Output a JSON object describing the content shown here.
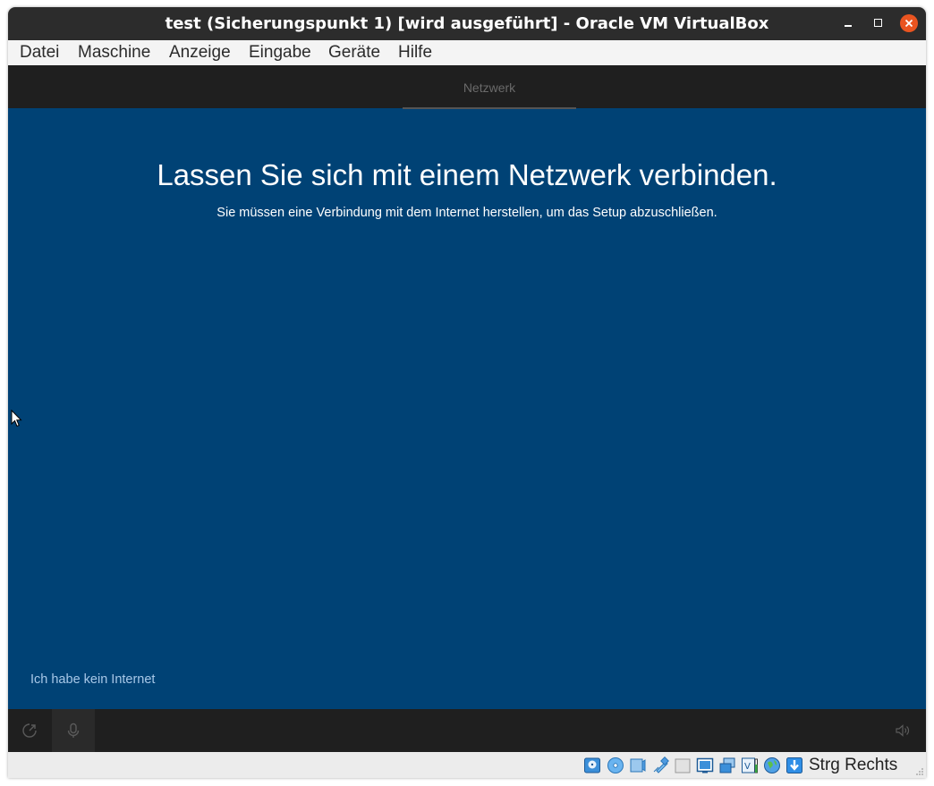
{
  "window": {
    "title": "test (Sicherungspunkt 1) [wird ausgeführt] - Oracle VM VirtualBox",
    "controls": [
      "minimize-icon",
      "maximize-icon",
      "close-icon"
    ]
  },
  "menubar": {
    "items": [
      {
        "label": "Datei"
      },
      {
        "label": "Maschine"
      },
      {
        "label": "Anzeige"
      },
      {
        "label": "Eingabe"
      },
      {
        "label": "Geräte"
      },
      {
        "label": "Hilfe"
      }
    ]
  },
  "guest": {
    "tab_label": "Netzwerk",
    "heading": "Lassen Sie sich mit einem Netzwerk verbinden.",
    "subheading": "Sie müssen eine Verbindung mit dem Internet herstellen, um das Setup abzuschließen.",
    "no_internet_link": "Ich habe kein Internet",
    "footer_icons": [
      "ease-of-access-icon",
      "microphone-icon",
      "volume-icon"
    ]
  },
  "statusbar": {
    "icons": [
      "hard-disk-icon",
      "optical-drive-icon",
      "audio-icon",
      "network-icon",
      "usb-icon",
      "shared-folders-icon",
      "display-icon",
      "video-capture-icon",
      "recording-icon",
      "cpu-virtualization-icon",
      "mouse-integration-icon",
      "keyboard-capture-icon"
    ],
    "host_key": "Strg Rechts"
  },
  "colors": {
    "titlebar": "#2c2c2c",
    "close_button": "#e95420",
    "guest_background": "#004275",
    "guest_bars": "#1f1f1f",
    "link": "#a8c8e8"
  }
}
